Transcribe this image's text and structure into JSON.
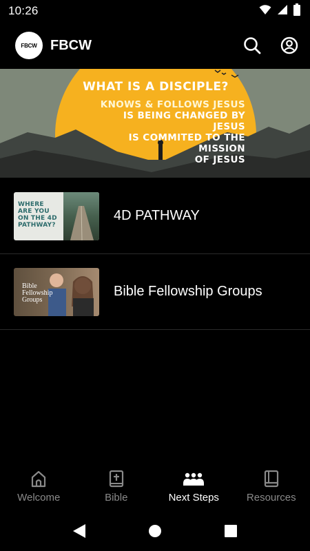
{
  "status_bar": {
    "time": "10:26",
    "icons": [
      "wifi-icon",
      "cell-signal-icon",
      "battery-icon"
    ]
  },
  "app_bar": {
    "logo_text": "FBCW",
    "title": "FBCW",
    "actions": [
      "search-icon",
      "account-icon"
    ]
  },
  "hero": {
    "title": "WHAT IS A DISCIPLE?",
    "lines": [
      "KNOWS & FOLLOWS JESUS",
      "IS BEING CHANGED BY",
      "JESUS",
      "IS COMMITED TO THE",
      "MISSION",
      "OF JESUS"
    ]
  },
  "list": [
    {
      "label": "4D PATHWAY",
      "thumb_text": [
        "WHERE",
        "ARE YOU",
        "ON THE 4D",
        "PATHWAY?"
      ]
    },
    {
      "label": "Bible Fellowship Groups",
      "thumb_text": [
        "Bible",
        "Fellowship",
        "Groups"
      ]
    }
  ],
  "bottom_nav": [
    {
      "label": "Welcome",
      "icon": "church-icon",
      "active": false
    },
    {
      "label": "Bible",
      "icon": "bible-icon",
      "active": false
    },
    {
      "label": "Next Steps",
      "icon": "people-icon",
      "active": true
    },
    {
      "label": "Resources",
      "icon": "book-icon",
      "active": false
    }
  ],
  "colors": {
    "background": "#000000",
    "active": "#ffffff",
    "inactive": "#8a8a8a",
    "hero_sun": "#f6b11f",
    "hero_sky": "#7e8879"
  }
}
